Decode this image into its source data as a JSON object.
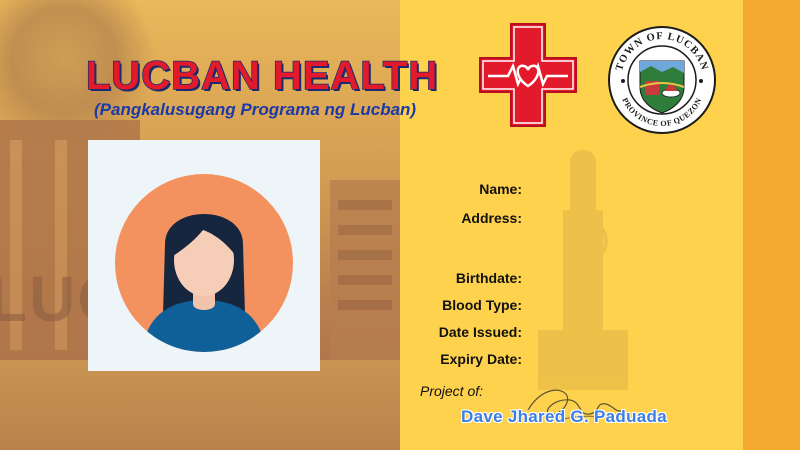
{
  "header": {
    "title": "LUCBAN HEALTH",
    "subtitle": "(Pangkalusugang Programa ng Lucban)"
  },
  "logos": {
    "cross_icon": "red-cross-heartbeat-icon",
    "seal_top_text": "TOWN OF LUCBAN",
    "seal_bottom_text": "PROVINCE OF QUEZON"
  },
  "background": {
    "building_letters": "LUCB"
  },
  "photo": {
    "icon": "avatar-placeholder-icon"
  },
  "fields": [
    {
      "label": "Name:"
    },
    {
      "label": "Address:"
    },
    {
      "label": "Birthdate:"
    },
    {
      "label": "Blood Type:"
    },
    {
      "label": "Date Issued:"
    },
    {
      "label": "Expiry Date:"
    }
  ],
  "footer": {
    "project_label": "Project of:",
    "author": "Dave Jhared G. Paduada"
  },
  "colors": {
    "card_yellow": "#ffd24d",
    "stripe_orange": "#f5aa2f",
    "title_red": "#e21a2b",
    "title_outline_navy": "#1b2b6f",
    "subtitle_blue": "#1b3aa6",
    "author_blue": "#3b7ee6",
    "avatar_circle": "#f4925f",
    "avatar_shirt": "#0f5f98"
  }
}
